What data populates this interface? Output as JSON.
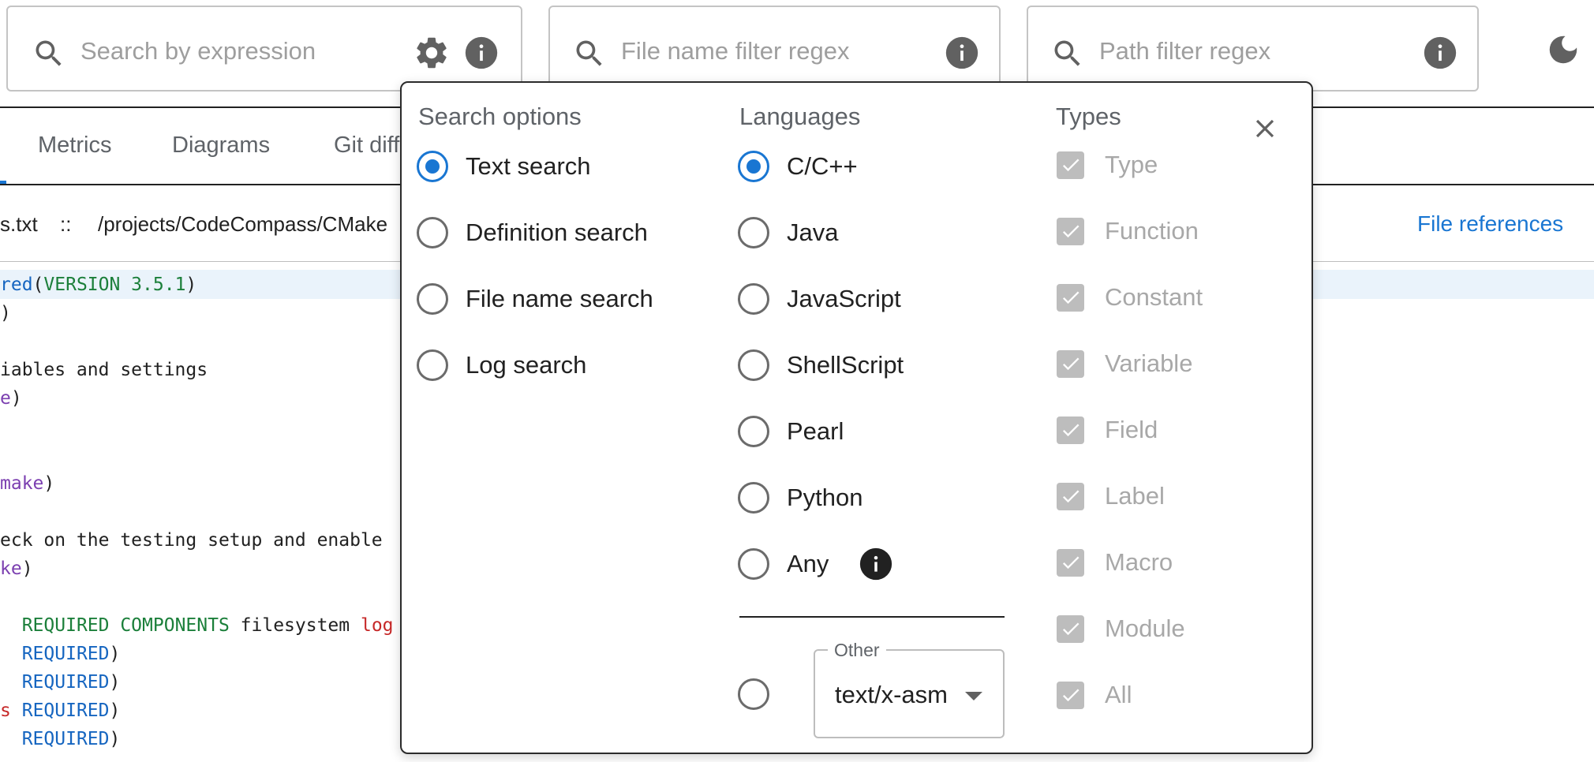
{
  "search": {
    "expression_placeholder": "Search by expression",
    "filename_placeholder": "File name filter regex",
    "path_placeholder": "Path filter regex"
  },
  "tabs": [
    "Metrics",
    "Diagrams",
    "Git diff"
  ],
  "breadcrumb": {
    "file": "s.txt",
    "separator": "::",
    "path": "/projects/CodeCompass/CMake"
  },
  "file_references_label": "File references",
  "code_lines": [
    [
      {
        "t": "red",
        "c": "blue"
      },
      {
        "t": "(",
        "c": ""
      },
      {
        "t": "VERSION 3.5.1",
        "c": "green"
      },
      {
        "t": ")",
        "c": ""
      }
    ],
    [
      {
        "t": ")",
        "c": ""
      }
    ],
    [],
    [
      {
        "t": "iables and settings",
        "c": ""
      }
    ],
    [
      {
        "t": "e",
        "c": "purple"
      },
      {
        "t": ")",
        "c": ""
      }
    ],
    [],
    [],
    [
      {
        "t": "make",
        "c": "purple"
      },
      {
        "t": ")",
        "c": ""
      }
    ],
    [],
    [
      {
        "t": "eck on the testing setup and enable",
        "c": ""
      }
    ],
    [
      {
        "t": "ke",
        "c": "purple"
      },
      {
        "t": ")",
        "c": ""
      }
    ],
    [],
    [
      {
        "t": "  ",
        "c": ""
      },
      {
        "t": "REQUIRED COMPONENTS",
        "c": "green"
      },
      {
        "t": " filesystem ",
        "c": ""
      },
      {
        "t": "log",
        "c": "red"
      }
    ],
    [
      {
        "t": "  ",
        "c": ""
      },
      {
        "t": "REQUIRED",
        "c": "blue"
      },
      {
        "t": ")",
        "c": ""
      }
    ],
    [
      {
        "t": "  ",
        "c": ""
      },
      {
        "t": "REQUIRED",
        "c": "blue"
      },
      {
        "t": ")",
        "c": ""
      }
    ],
    [
      {
        "t": "s",
        "c": "red"
      },
      {
        "t": " ",
        "c": ""
      },
      {
        "t": "REQUIRED",
        "c": "blue"
      },
      {
        "t": ")",
        "c": ""
      }
    ],
    [
      {
        "t": "  ",
        "c": ""
      },
      {
        "t": "REQUIRED",
        "c": "blue"
      },
      {
        "t": ")",
        "c": ""
      }
    ]
  ],
  "popup": {
    "search_options": {
      "title": "Search options",
      "options": [
        "Text search",
        "Definition search",
        "File name search",
        "Log search"
      ],
      "selected": 0
    },
    "languages": {
      "title": "Languages",
      "options": [
        "C/C++",
        "Java",
        "JavaScript",
        "ShellScript",
        "Pearl",
        "Python",
        "Any"
      ],
      "selected": 0,
      "other_label": "Other",
      "other_value": "text/x-asm"
    },
    "types": {
      "title": "Types",
      "options": [
        "Type",
        "Function",
        "Constant",
        "Variable",
        "Field",
        "Label",
        "Macro",
        "Module",
        "All"
      ]
    }
  },
  "colors": {
    "accent": "#1976d2",
    "highlight_line": "#eaf3fb"
  }
}
